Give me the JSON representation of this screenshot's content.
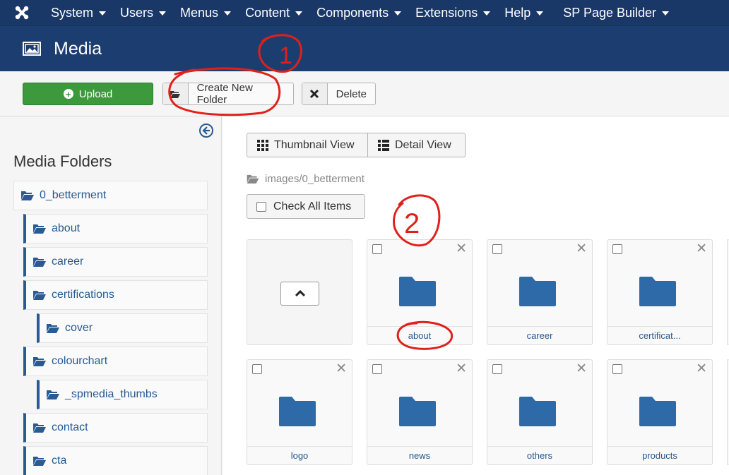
{
  "navbar": {
    "items": [
      {
        "label": "System"
      },
      {
        "label": "Users"
      },
      {
        "label": "Menus"
      },
      {
        "label": "Content"
      },
      {
        "label": "Components"
      },
      {
        "label": "Extensions"
      },
      {
        "label": "Help"
      },
      {
        "label": "SP Page Builder"
      }
    ]
  },
  "header": {
    "title": "Media",
    "icon": "image-icon"
  },
  "toolbar": {
    "upload_label": "Upload",
    "create_folder_label": "Create New Folder",
    "delete_label": "Delete"
  },
  "sidebar": {
    "title": "Media Folders",
    "folders": [
      {
        "name": "0_betterment",
        "level": 0
      },
      {
        "name": "about",
        "level": 1
      },
      {
        "name": "career",
        "level": 1
      },
      {
        "name": "certifications",
        "level": 1
      },
      {
        "name": "cover",
        "level": 2
      },
      {
        "name": "colourchart",
        "level": 1
      },
      {
        "name": "_spmedia_thumbs",
        "level": 2
      },
      {
        "name": "contact",
        "level": 1
      },
      {
        "name": "cta",
        "level": 1
      }
    ]
  },
  "main": {
    "views": {
      "thumbnail": "Thumbnail View",
      "detail": "Detail View"
    },
    "path": "images/0_betterment",
    "check_all_label": "Check All Items",
    "tiles": [
      {
        "label": "about"
      },
      {
        "label": "career"
      },
      {
        "label": "certificat..."
      },
      {
        "label": "logo"
      },
      {
        "label": "news"
      },
      {
        "label": "others"
      },
      {
        "label": "products"
      }
    ]
  },
  "annotations": {
    "marker1": "1",
    "marker2": "2",
    "color": "#e0201b"
  },
  "colors": {
    "navbar": "#1a3867",
    "header": "#1c3d6f",
    "upload": "#3c9a3c",
    "link": "#245a92",
    "folder": "#2e6aa8"
  }
}
